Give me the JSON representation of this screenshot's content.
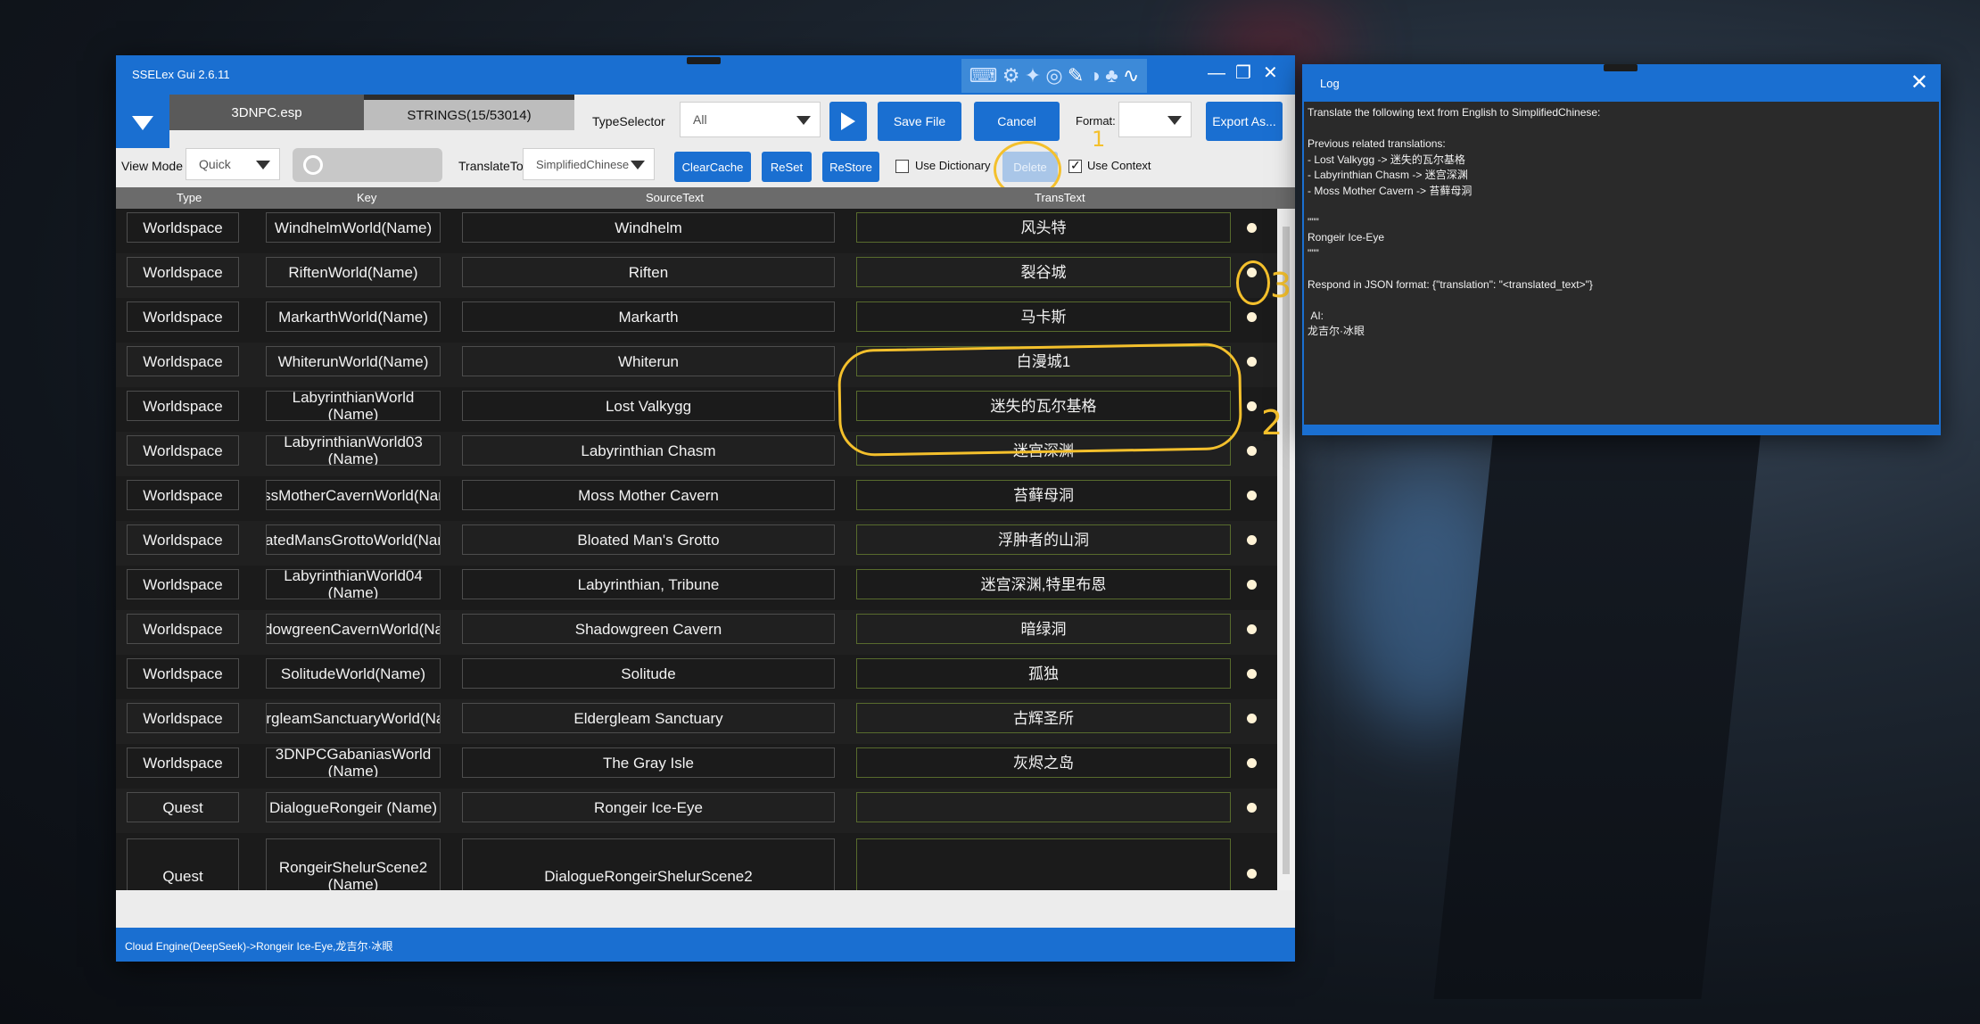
{
  "main_window": {
    "title": "SSELex Gui 2.6.11",
    "tabs": [
      {
        "label": "3DNPC.esp"
      },
      {
        "label": "STRINGS(15/53014)"
      }
    ],
    "type_selector_label": "TypeSelector",
    "type_selector_value": "All",
    "save_label": "Save File",
    "cancel_label": "Cancel",
    "format_label": "Format:",
    "export_label": "Export As...",
    "view_mode_label": "View Mode",
    "view_mode_value": "Quick",
    "translate_to_label": "TranslateTo",
    "translate_to_value": "SimplifiedChinese",
    "clearcache_label": "ClearCache",
    "reset_label": "ReSet",
    "restore_label": "ReStore",
    "use_dictionary_label": "Use Dictionary",
    "delete_label": "Delete",
    "use_context_label": "Use Context",
    "use_dictionary_checked": false,
    "use_context_checked": true,
    "annotations": [
      "1",
      "2",
      "3"
    ],
    "columns": [
      "Type",
      "Key",
      "SourceText",
      "TransText"
    ],
    "rows": [
      {
        "type": "Worldspace",
        "key": "WindhelmWorld(Name)",
        "source": "Windhelm",
        "trans": "风头特"
      },
      {
        "type": "Worldspace",
        "key": "RiftenWorld(Name)",
        "source": "Riften",
        "trans": "裂谷城"
      },
      {
        "type": "Worldspace",
        "key": "MarkarthWorld(Name)",
        "source": "Markarth",
        "trans": "马卡斯"
      },
      {
        "type": "Worldspace",
        "key": "WhiterunWorld(Name)",
        "source": "Whiterun",
        "trans": "白漫城1"
      },
      {
        "type": "Worldspace",
        "key": "LabyrinthianWorld (Name)",
        "source": "Lost Valkygg",
        "trans": "迷失的瓦尔基格"
      },
      {
        "type": "Worldspace",
        "key": "LabyrinthianWorld03 (Name)",
        "source": "Labyrinthian Chasm",
        "trans": "迷宫深渊"
      },
      {
        "type": "Worldspace",
        "key": "MossMotherCavernWorld(Name)",
        "source": "Moss Mother Cavern",
        "trans": "苔藓母洞"
      },
      {
        "type": "Worldspace",
        "key": "BloatedMansGrottoWorld(Name)",
        "source": "Bloated Man's Grotto",
        "trans": "浮肿者的山洞"
      },
      {
        "type": "Worldspace",
        "key": "LabyrinthianWorld04 (Name)",
        "source": "Labyrinthian, Tribune",
        "trans": "迷宫深渊,特里布恩"
      },
      {
        "type": "Worldspace",
        "key": "ShadowgreenCavernWorld(Name)",
        "source": "Shadowgreen Cavern",
        "trans": "暗绿洞"
      },
      {
        "type": "Worldspace",
        "key": "SolitudeWorld(Name)",
        "source": "Solitude",
        "trans": "孤独"
      },
      {
        "type": "Worldspace",
        "key": "EldergleamSanctuaryWorld(Name)",
        "source": "Eldergleam Sanctuary",
        "trans": "古辉圣所"
      },
      {
        "type": "Worldspace",
        "key": "3DNPCGabaniasWorld (Name)",
        "source": "The Gray Isle",
        "trans": "灰烬之岛"
      },
      {
        "type": "Quest",
        "key": "DialogueRongeir (Name)",
        "source": "Rongeir Ice-Eye",
        "trans": ""
      },
      {
        "type": "Quest",
        "key": "RongeirShelurScene2 (Name)",
        "source": "DialogueRongeirShelurScene2",
        "trans": ""
      }
    ],
    "status": "Cloud Engine(DeepSeek)->Rongeir Ice-Eye,龙吉尔·冰眼"
  },
  "log_window": {
    "title": "Log",
    "text": "Translate the following text from English to SimplifiedChinese:\n\nPrevious related translations:\n- Lost Valkygg -> 迷失的瓦尔基格\n- Labyrinthian Chasm -> 迷宫深渊\n- Moss Mother Cavern -> 苔藓母洞\n\n\"\"\"\nRongeir Ice-Eye\n\"\"\"\n\nRespond in JSON format: {\"translation\": \"<translated_text>\"}\n\n AI:\n龙吉尔·冰眼"
  },
  "colors": {
    "accent": "#1a6fd1",
    "annotation": "#f4c02c",
    "grid_bg": "#1b1b1b"
  }
}
